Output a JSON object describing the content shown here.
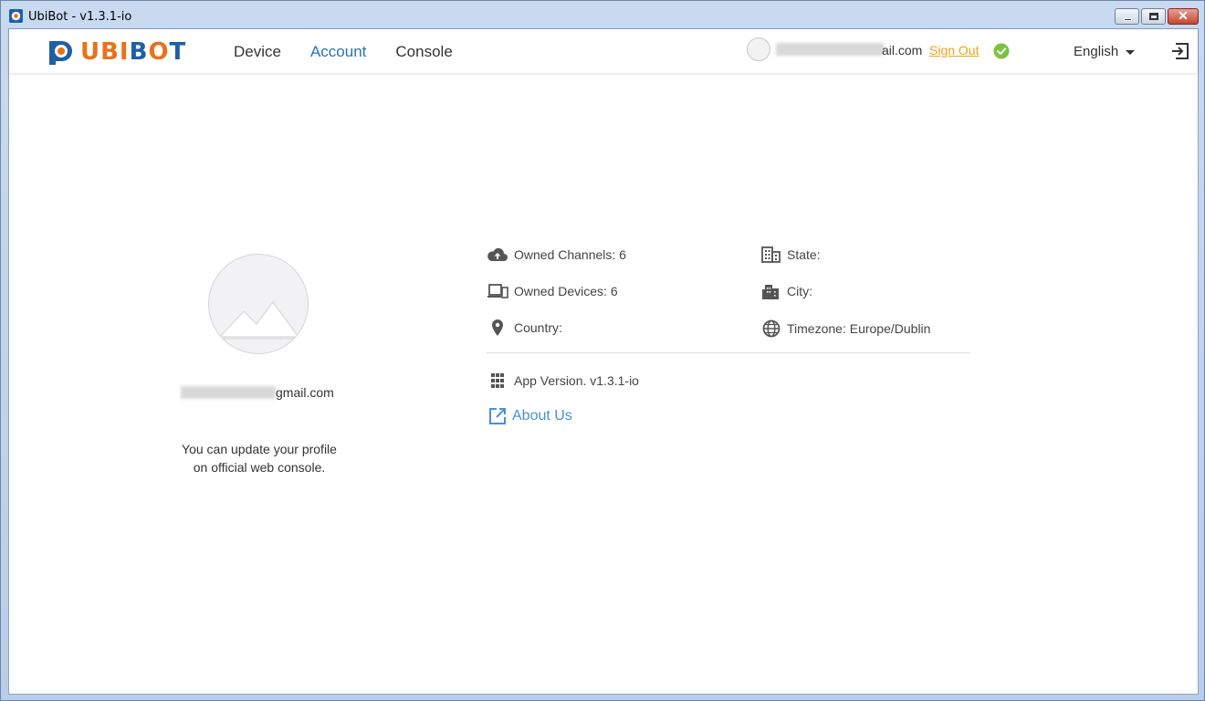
{
  "window": {
    "title": "UbiBot - v1.3.1-io"
  },
  "brand": {
    "logo_text_1": "UBI",
    "logo_text_2": "B",
    "logo_text_3": "O",
    "logo_text_4": "T",
    "accent_orange": "#e8721c",
    "accent_blue": "#1d5fa8"
  },
  "nav": {
    "items": [
      {
        "label": "Device"
      },
      {
        "label": "Account"
      },
      {
        "label": "Console"
      }
    ],
    "active": "Account"
  },
  "header": {
    "user_email_suffix": "ail.com",
    "sign_out": "Sign Out",
    "language": "English",
    "status_icon": "check-circle-icon",
    "exit_icon": "exit-icon"
  },
  "profile": {
    "email_suffix": "gmail.com",
    "note_line1": "You can update your profile",
    "note_line2": "on official web console."
  },
  "info": {
    "owned_channels": "Owned Channels: 6",
    "owned_devices": "Owned Devices: 6",
    "country": "Country:",
    "state": "State:",
    "city": "City:",
    "timezone": "Timezone: Europe/Dublin",
    "app_version": "App Version. v1.3.1-io",
    "about_us": "About Us"
  },
  "colors": {
    "link": "#4a8fd8",
    "sign_out": "#f0a21a",
    "check": "#7cc142"
  }
}
